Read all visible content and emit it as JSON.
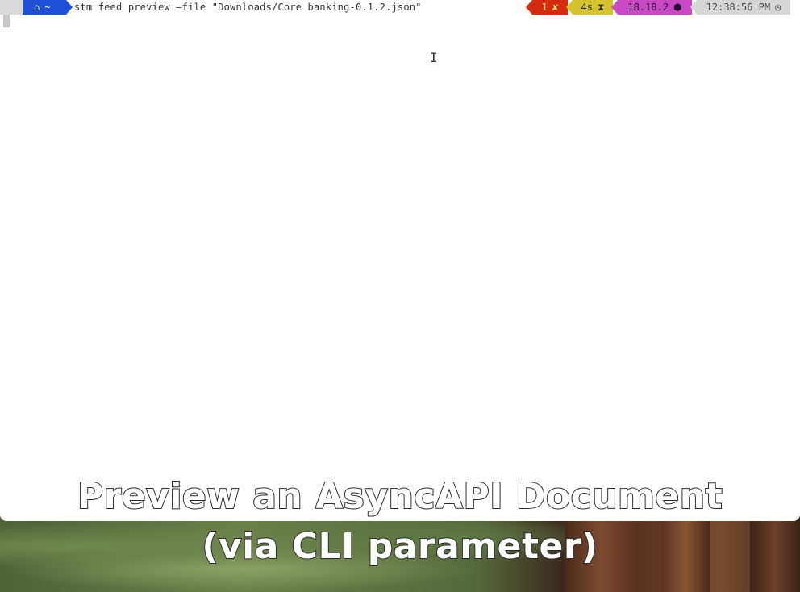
{
  "prompt": {
    "os_icon": "apple-icon",
    "dir_icon": "home-icon",
    "dir": "~",
    "command": "stm feed preview —file \"Downloads/Core banking-0.1.2.json\""
  },
  "status": {
    "exit_code": "1",
    "exit_icon": "✘",
    "duration": "4s",
    "duration_icon": "⧗",
    "node_version": "18.18.2",
    "node_icon": "⬢",
    "time": "12:38:56 PM",
    "time_icon": "◷"
  },
  "caption": {
    "line1": "Preview an AsyncAPI Document",
    "line2": "(via CLI parameter)"
  },
  "colors": {
    "dir_bg": "#1f4fd6",
    "status_bg": "#d42a0e",
    "duration_bg": "#d4c22e",
    "node_bg": "#c948c4",
    "time_bg": "#d6d6d6"
  }
}
